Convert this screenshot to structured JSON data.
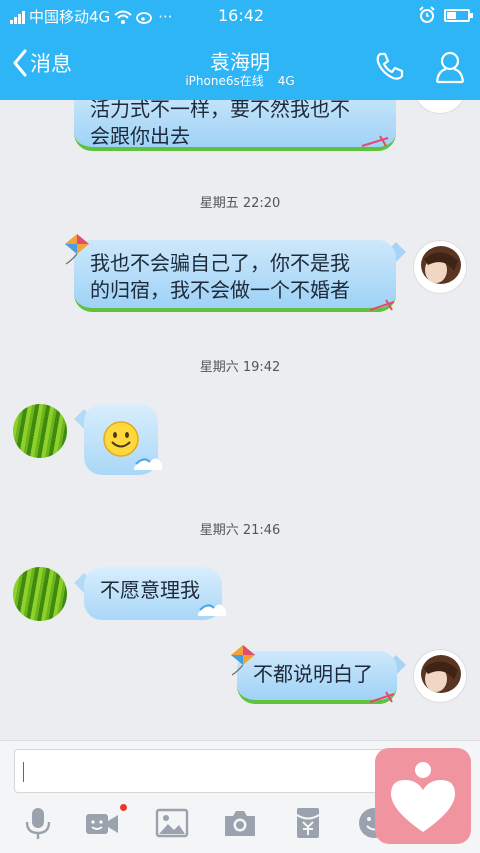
{
  "status_bar": {
    "carrier": "中国移动4G",
    "dots": "···",
    "time": "16:42"
  },
  "header": {
    "back_label": "消息",
    "contact_name": "袁海明",
    "device_status": "iPhone6s在线",
    "network": "4G"
  },
  "messages": [
    {
      "type": "outgoing",
      "text_lines": [
        "活力式不一样，要不然我也不",
        "会跟你出去"
      ]
    },
    {
      "type": "timestamp",
      "text": "星期五  22:20"
    },
    {
      "type": "outgoing",
      "text_lines": [
        "我也不会骗自己了，你不是我",
        "的归宿，我不会做一个不婚者"
      ]
    },
    {
      "type": "timestamp",
      "text": "星期六  19:42"
    },
    {
      "type": "incoming",
      "emoji": "smile-emoji"
    },
    {
      "type": "timestamp",
      "text": "星期六  21:46"
    },
    {
      "type": "incoming",
      "text": "不愿意理我"
    },
    {
      "type": "outgoing",
      "text": "不都说明白了"
    }
  ],
  "input": {
    "value": "",
    "placeholder": ""
  },
  "toolbar": {
    "icons": [
      "microphone-icon",
      "video-icon",
      "image-icon",
      "camera-icon",
      "red-packet-icon",
      "emoji-icon"
    ],
    "notification_dot_color": "#e8392f"
  },
  "colors": {
    "accent": "#2db5f5",
    "bubble": "#a9d7f8",
    "bubble_border": "#5ec23d",
    "floating_button": "#f0959f"
  }
}
